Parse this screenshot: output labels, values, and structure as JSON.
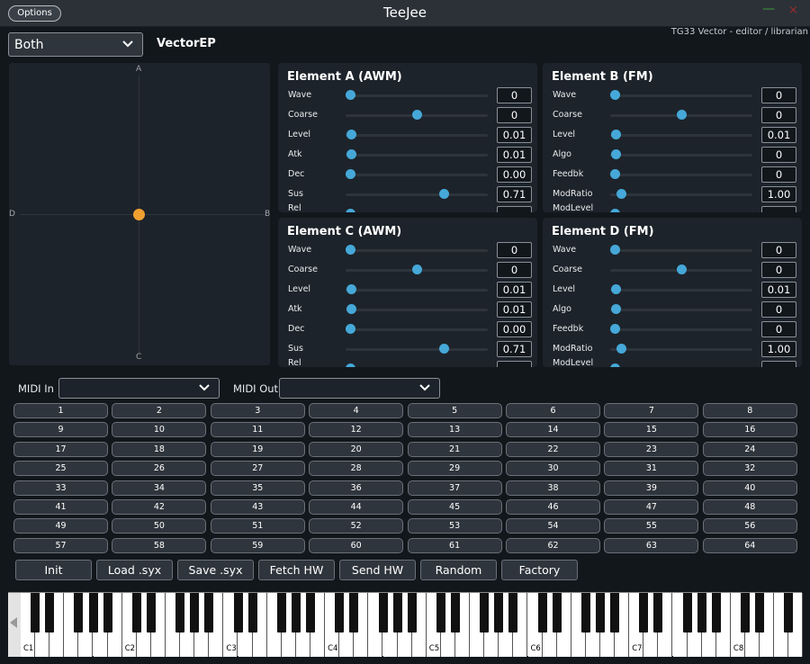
{
  "window": {
    "title": "TeeJee",
    "options_label": "Options",
    "minimize_glyph": "—",
    "close_glyph": "×"
  },
  "top": {
    "mode_combo": "Both",
    "patch_name": "VectorEP",
    "subtitle": "TG33 Vector - editor / librarian"
  },
  "vector_pad": {
    "label_a": "A",
    "label_b": "B",
    "label_c": "C",
    "label_d": "D",
    "point": {
      "x": 0,
      "y": 0
    }
  },
  "elements": [
    {
      "title": "Element A  (AWM)",
      "params": [
        {
          "label": "Wave",
          "value": "0",
          "level": 0.0
        },
        {
          "label": "Coarse",
          "value": "0",
          "level": 0.5
        },
        {
          "label": "Level",
          "value": "0.01",
          "level": 0.01
        },
        {
          "label": "Atk",
          "value": "0.01",
          "level": 0.01
        },
        {
          "label": "Dec",
          "value": "0.00",
          "level": 0.0
        },
        {
          "label": "Sus",
          "value": "0.71",
          "level": 0.71
        },
        {
          "label": "Rel",
          "value": "",
          "level": 0.0
        }
      ]
    },
    {
      "title": "Element B  (FM)",
      "params": [
        {
          "label": "Wave",
          "value": "0",
          "level": 0.0
        },
        {
          "label": "Coarse",
          "value": "0",
          "level": 0.5
        },
        {
          "label": "Level",
          "value": "0.01",
          "level": 0.01
        },
        {
          "label": "Algo",
          "value": "0",
          "level": 0.01
        },
        {
          "label": "Feedbk",
          "value": "0",
          "level": 0.0
        },
        {
          "label": "ModRatio",
          "value": "1.00",
          "level": 0.05
        },
        {
          "label": "ModLevel",
          "value": "",
          "level": 0.0
        }
      ]
    },
    {
      "title": "Element C  (AWM)",
      "params": [
        {
          "label": "Wave",
          "value": "0",
          "level": 0.0
        },
        {
          "label": "Coarse",
          "value": "0",
          "level": 0.5
        },
        {
          "label": "Level",
          "value": "0.01",
          "level": 0.01
        },
        {
          "label": "Atk",
          "value": "0.01",
          "level": 0.01
        },
        {
          "label": "Dec",
          "value": "0.00",
          "level": 0.0
        },
        {
          "label": "Sus",
          "value": "0.71",
          "level": 0.71
        },
        {
          "label": "Rel",
          "value": "",
          "level": 0.0
        }
      ]
    },
    {
      "title": "Element D  (FM)",
      "params": [
        {
          "label": "Wave",
          "value": "0",
          "level": 0.0
        },
        {
          "label": "Coarse",
          "value": "0",
          "level": 0.5
        },
        {
          "label": "Level",
          "value": "0.01",
          "level": 0.01
        },
        {
          "label": "Algo",
          "value": "0",
          "level": 0.01
        },
        {
          "label": "Feedbk",
          "value": "0",
          "level": 0.0
        },
        {
          "label": "ModRatio",
          "value": "1.00",
          "level": 0.05
        },
        {
          "label": "ModLevel",
          "value": "",
          "level": 0.0
        }
      ]
    }
  ],
  "midi": {
    "in_label": "MIDI In",
    "out_label": "MIDI Out",
    "in_value": "",
    "out_value": ""
  },
  "patches": [
    "1",
    "2",
    "3",
    "4",
    "5",
    "6",
    "7",
    "8",
    "9",
    "10",
    "11",
    "12",
    "13",
    "14",
    "15",
    "16",
    "17",
    "18",
    "19",
    "20",
    "21",
    "22",
    "23",
    "24",
    "25",
    "26",
    "27",
    "28",
    "29",
    "30",
    "31",
    "32",
    "33",
    "34",
    "35",
    "36",
    "37",
    "38",
    "39",
    "40",
    "41",
    "42",
    "43",
    "44",
    "45",
    "46",
    "47",
    "48",
    "49",
    "50",
    "51",
    "52",
    "53",
    "54",
    "55",
    "56",
    "57",
    "58",
    "59",
    "60",
    "61",
    "62",
    "63",
    "64"
  ],
  "actions": [
    "Init",
    "Load .syx",
    "Save .syx",
    "Fetch HW",
    "Send HW",
    "Random",
    "Factory"
  ],
  "keyboard": {
    "octave_labels": [
      "C1",
      "C2",
      "C3",
      "C4",
      "C5",
      "C6",
      "C7",
      "C8"
    ]
  },
  "colors": {
    "accent": "#45a8d8",
    "vector_point": "#f0a030",
    "background": "#12171c",
    "panel": "#1d232a"
  }
}
